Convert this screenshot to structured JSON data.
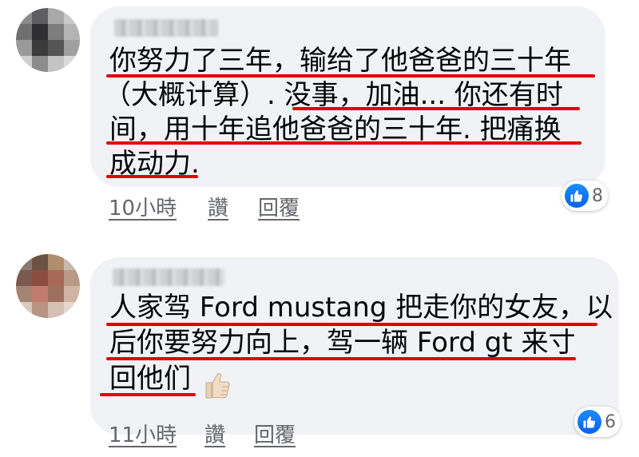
{
  "comments": [
    {
      "text_lines": [
        "你努力了三年，输给了他爸爸的三十年",
        "（大概计算）. 没事，加油... 你还有时",
        "间，用十年追他爸爸的三十年. 把痛换",
        "成动力."
      ],
      "time": "10小時",
      "like_label": "讚",
      "reply_label": "回覆",
      "reaction_icon": "like-icon",
      "reaction_count": "8"
    },
    {
      "text_lines": [
        "人家驾 Ford mustang 把走你的女友，以",
        "后你要努力向上，驾一辆 Ford gt 来寸",
        "回他们"
      ],
      "emoji": "thumbs-up",
      "time": "11小時",
      "like_label": "讚",
      "reply_label": "回覆",
      "reaction_icon": "like-icon",
      "reaction_count": "6"
    }
  ],
  "colors": {
    "bubble": "#f0f2f5",
    "underline_annotation": "#e00000",
    "action_text": "#65676b",
    "like_blue": "#1877f2"
  }
}
